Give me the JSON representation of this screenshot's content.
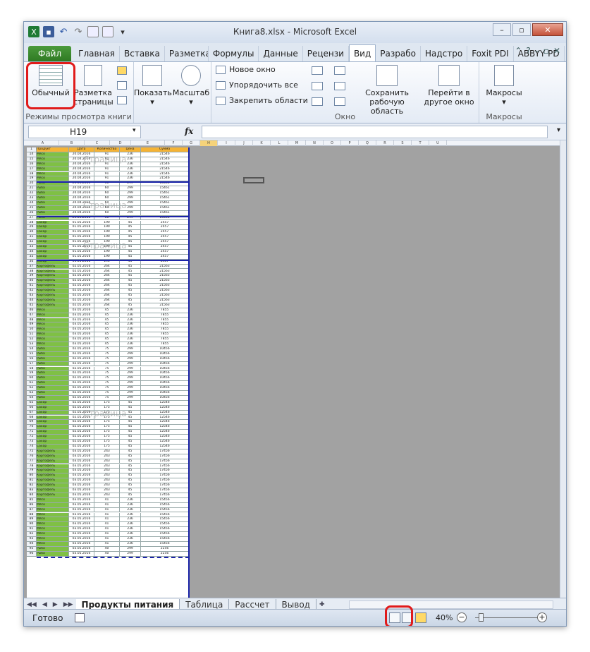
{
  "window": {
    "title": "Книга8.xlsx - Microsoft Excel"
  },
  "ribbon_tabs": [
    "Файл",
    "Главная",
    "Вставка",
    "Разметка",
    "Формулы",
    "Данные",
    "Рецензи",
    "Вид",
    "Разрабо",
    "Надстро",
    "Foxit PDI",
    "ABBYY PD"
  ],
  "active_tab": "Вид",
  "ribbon": {
    "g1": {
      "b1": "Обычный",
      "b2": "Разметка страницы",
      "label": "Режимы просмотра книги"
    },
    "g2": {
      "b1": "Показать",
      "b2": "Масштаб"
    },
    "g3": {
      "s1": "Новое окно",
      "s2": "Упорядочить все",
      "s3": "Закрепить области",
      "b1": "Сохранить рабочую область",
      "b2": "Перейти в другое окно",
      "label": "Окно"
    },
    "g4": {
      "b1": "Макросы",
      "label": "Макросы"
    }
  },
  "formula_bar": {
    "name_box": "H19",
    "fx": "fx",
    "value": ""
  },
  "columns": [
    "A",
    "B",
    "C",
    "D",
    "E",
    "F",
    "G",
    "H",
    "I",
    "J",
    "K",
    "L",
    "M",
    "N",
    "O",
    "P",
    "Q",
    "R",
    "S",
    "T",
    "U"
  ],
  "selected_column": "H",
  "header_row": [
    "Продукт",
    "Дата",
    "Количество",
    "Цена",
    "Сумма"
  ],
  "rows": [
    [
      "Мясо",
      "20.04.2016",
      "91",
      "236",
      "21546"
    ],
    [
      "Мясо",
      "20.04.2016",
      "91",
      "236",
      "21546"
    ],
    [
      "Мясо",
      "20.04.2016",
      "91",
      "236",
      "21546"
    ],
    [
      "Мясо",
      "20.04.2016",
      "91",
      "236",
      "21546"
    ],
    [
      "Мясо",
      "20.04.2016",
      "91",
      "236",
      "21546"
    ],
    [
      "Мясо",
      "20.04.2016",
      "91",
      "236",
      "21546"
    ],
    [
      "Рыба",
      "20.04.2016",
      "60",
      "299",
      "15461"
    ],
    [
      "Рыба",
      "20.04.2016",
      "60",
      "299",
      "15461"
    ],
    [
      "Рыба",
      "20.04.2016",
      "60",
      "299",
      "15461"
    ],
    [
      "Рыба",
      "20.04.2016",
      "60",
      "299",
      "15461"
    ],
    [
      "Рыба",
      "20.04.2016",
      "60",
      "299",
      "15461"
    ],
    [
      "Рыба",
      "20.04.2016",
      "60",
      "299",
      "15461"
    ],
    [
      "Рыба",
      "20.04.2016",
      "60",
      "299",
      "15461"
    ],
    [
      "Рыба",
      "20.04.2016",
      "60",
      "299",
      "15461"
    ],
    [
      "Сахар",
      "01.05.2016",
      "190",
      "45",
      "2457"
    ],
    [
      "Сахар",
      "01.05.2016",
      "190",
      "45",
      "2457"
    ],
    [
      "Сахар",
      "01.05.2016",
      "190",
      "45",
      "2457"
    ],
    [
      "Сахар",
      "01.05.2016",
      "190",
      "45",
      "2457"
    ],
    [
      "Сахар",
      "01.05.2016",
      "190",
      "45",
      "2457"
    ],
    [
      "Сахар",
      "01.05.2016",
      "190",
      "45",
      "2457"
    ],
    [
      "Сахар",
      "01.05.2016",
      "190",
      "45",
      "2457"
    ],
    [
      "Сахар",
      "01.05.2016",
      "190",
      "45",
      "2457"
    ],
    [
      "Сахар",
      "01.05.2016",
      "190",
      "45",
      "2457"
    ],
    [
      "Картофель",
      "02.05.2016",
      "264",
      "45",
      "21563"
    ],
    [
      "Картофель",
      "02.05.2016",
      "264",
      "45",
      "21563"
    ],
    [
      "Картофель",
      "02.05.2016",
      "264",
      "45",
      "21563"
    ],
    [
      "Картофель",
      "02.05.2016",
      "264",
      "45",
      "21563"
    ],
    [
      "Картофель",
      "02.05.2016",
      "264",
      "45",
      "21563"
    ],
    [
      "Картофель",
      "02.05.2016",
      "264",
      "45",
      "21563"
    ],
    [
      "Картофель",
      "02.05.2016",
      "264",
      "45",
      "21563"
    ],
    [
      "Картофель",
      "02.05.2016",
      "264",
      "45",
      "21563"
    ],
    [
      "Картофель",
      "02.05.2016",
      "264",
      "45",
      "21563"
    ],
    [
      "Мясо",
      "03.05.2016",
      "45",
      "236",
      "7855"
    ],
    [
      "Мясо",
      "03.05.2016",
      "45",
      "236",
      "7855"
    ],
    [
      "Мясо",
      "03.05.2016",
      "45",
      "236",
      "7855"
    ],
    [
      "Мясо",
      "03.05.2016",
      "45",
      "236",
      "7855"
    ],
    [
      "Мясо",
      "03.05.2016",
      "45",
      "236",
      "7855"
    ],
    [
      "Мясо",
      "03.05.2016",
      "45",
      "236",
      "7855"
    ],
    [
      "Мясо",
      "03.05.2016",
      "45",
      "236",
      "7855"
    ],
    [
      "Мясо",
      "03.05.2016",
      "45",
      "236",
      "7855"
    ],
    [
      "Рыба",
      "02.05.2016",
      "75",
      "299",
      "10456"
    ],
    [
      "Рыба",
      "02.05.2016",
      "75",
      "299",
      "10456"
    ],
    [
      "Рыба",
      "02.05.2016",
      "75",
      "299",
      "10456"
    ],
    [
      "Рыба",
      "02.05.2016",
      "75",
      "299",
      "10456"
    ],
    [
      "Рыба",
      "02.05.2016",
      "75",
      "299",
      "10456"
    ],
    [
      "Рыба",
      "02.05.2016",
      "75",
      "299",
      "10456"
    ],
    [
      "Рыба",
      "02.05.2016",
      "75",
      "299",
      "10456"
    ],
    [
      "Рыба",
      "02.05.2016",
      "75",
      "299",
      "10456"
    ],
    [
      "Рыба",
      "02.05.2016",
      "75",
      "299",
      "10456"
    ],
    [
      "Рыба",
      "02.05.2016",
      "75",
      "299",
      "10456"
    ],
    [
      "Рыба",
      "02.05.2016",
      "75",
      "299",
      "10456"
    ],
    [
      "Сахар",
      "02.05.2016",
      "175",
      "45",
      "12546"
    ],
    [
      "Сахар",
      "02.05.2016",
      "175",
      "45",
      "12546"
    ],
    [
      "Сахар",
      "02.05.2016",
      "175",
      "45",
      "12546"
    ],
    [
      "Сахар",
      "02.05.2016",
      "175",
      "45",
      "12546"
    ],
    [
      "Сахар",
      "02.05.2016",
      "175",
      "45",
      "12546"
    ],
    [
      "Сахар",
      "02.05.2016",
      "175",
      "45",
      "12546"
    ],
    [
      "Сахар",
      "02.05.2016",
      "175",
      "45",
      "12546"
    ],
    [
      "Сахар",
      "02.05.2016",
      "175",
      "45",
      "12546"
    ],
    [
      "Сахар",
      "02.05.2016",
      "175",
      "45",
      "12546"
    ],
    [
      "Сахар",
      "02.05.2016",
      "175",
      "45",
      "12546"
    ],
    [
      "Картофель",
      "03.05.2016",
      "243",
      "45",
      "17456"
    ],
    [
      "Картофель",
      "03.05.2016",
      "243",
      "45",
      "17456"
    ],
    [
      "Картофель",
      "03.05.2016",
      "243",
      "45",
      "17456"
    ],
    [
      "Картофель",
      "03.05.2016",
      "243",
      "45",
      "17456"
    ],
    [
      "Картофель",
      "03.05.2016",
      "243",
      "45",
      "17456"
    ],
    [
      "Картофель",
      "03.05.2016",
      "243",
      "45",
      "17456"
    ],
    [
      "Картофель",
      "03.05.2016",
      "243",
      "45",
      "17456"
    ],
    [
      "Картофель",
      "03.05.2016",
      "243",
      "45",
      "17456"
    ],
    [
      "Картофель",
      "03.05.2016",
      "243",
      "45",
      "17456"
    ],
    [
      "Картофель",
      "03.05.2016",
      "243",
      "45",
      "17456"
    ],
    [
      "Мясо",
      "03.05.2016",
      "41",
      "236",
      "15456"
    ],
    [
      "Мясо",
      "03.05.2016",
      "41",
      "236",
      "15456"
    ],
    [
      "Мясо",
      "03.05.2016",
      "41",
      "236",
      "15456"
    ],
    [
      "Мясо",
      "03.05.2016",
      "41",
      "236",
      "15456"
    ],
    [
      "Мясо",
      "03.05.2016",
      "41",
      "236",
      "15456"
    ],
    [
      "Мясо",
      "03.05.2016",
      "41",
      "236",
      "15456"
    ],
    [
      "Мясо",
      "03.05.2016",
      "41",
      "236",
      "15456"
    ],
    [
      "Мясо",
      "03.05.2016",
      "41",
      "236",
      "15456"
    ],
    [
      "Мясо",
      "03.05.2016",
      "41",
      "236",
      "15456"
    ],
    [
      "Мясо",
      "03.05.2016",
      "41",
      "236",
      "15456"
    ],
    [
      "Рыба",
      "03.05.2016",
      "40",
      "299",
      "2256"
    ],
    [
      "Рыба",
      "03.05.2016",
      "40",
      "299",
      "2256"
    ]
  ],
  "first_row_number": 14,
  "watermark": "Страница",
  "sheet_tabs": [
    "Продукты питания",
    "Таблица",
    "Рассчет",
    "Вывод"
  ],
  "status": {
    "ready": "Готово",
    "zoom": "40%",
    "minus": "−",
    "plus": "+"
  },
  "colors": {
    "accent_red": "#e01b1b",
    "file_tab": "#2f7a23",
    "page_break": "#1a23a8",
    "col_a_fill": "#7fc045"
  }
}
